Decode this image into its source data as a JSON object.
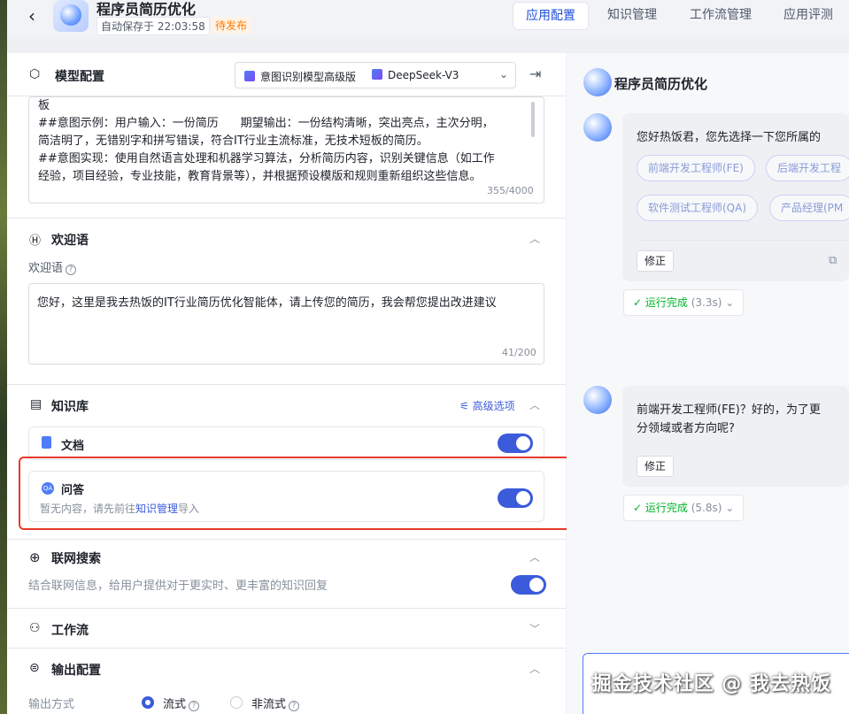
{
  "header": {
    "back_symbol": "‹",
    "app_title": "程序员简历优化",
    "autosave": "自动保存于 22:03:58",
    "status": "待发布",
    "tabs": [
      {
        "label": "应用配置",
        "active": true
      },
      {
        "label": "知识管理",
        "active": false
      },
      {
        "label": "工作流管理",
        "active": false
      },
      {
        "label": "应用评测",
        "active": false
      }
    ]
  },
  "model_config": {
    "title": "模型配置",
    "intent_model": "意图识别模型高级版",
    "llm_model": "DeepSeek-V3",
    "prompt_lines": [
      "板",
      "##意图示例：用户输入：一份简历      期望输出：一份结构清晰，突出亮点，主次分明，",
      "简洁明了，无错别字和拼写错误，符合IT行业主流标准，无技术短板的简历。",
      "##意图实现：使用自然语言处理和机器学习算法，分析简历内容，识别关键信息（如工作",
      "经验，项目经验，专业技能，教育背景等），并根据预设模版和规则重新组织这些信息。"
    ],
    "prompt_counter": "355/4000"
  },
  "welcome": {
    "title": "欢迎语",
    "label": "欢迎语",
    "text": "您好，这里是我去热饭的IT行业简历优化智能体，请上传您的简历，我会帮您提出改进建议",
    "counter": "41/200"
  },
  "knowledge": {
    "title": "知识库",
    "advanced": "高级选项",
    "doc_label": "文档",
    "doc_enabled": true,
    "qa_label": "问答",
    "qa_hint_prefix": "暂无内容，请先前往",
    "qa_hint_link": "知识管理",
    "qa_hint_suffix": "导入",
    "qa_enabled": true
  },
  "web_search": {
    "title": "联网搜索",
    "desc": "结合联网信息，给用户提供对于更实时、更丰富的知识回复",
    "enabled": true
  },
  "workflow": {
    "title": "工作流"
  },
  "output": {
    "title": "输出配置",
    "mode_label": "输出方式",
    "options": [
      {
        "label": "流式",
        "selected": true
      },
      {
        "label": "非流式",
        "selected": false
      }
    ]
  },
  "preview": {
    "title": "程序员简历优化",
    "msg1_text": "您好热饭君，您先选择一下您所属的",
    "chips": [
      "前端开发工程师(FE)",
      "后端开发工程",
      "软件测试工程师(QA)",
      "产品经理(PM"
    ],
    "fix_label": "修正",
    "run1_status": "运行完成",
    "run1_time": "(3.3s)",
    "msg2_line1": "前端开发工程师(FE)？好的，为了更",
    "msg2_line2": "分领域或者方向呢?",
    "run2_status": "运行完成",
    "run2_time": "(5.8s)"
  },
  "watermark": "掘金技术社区 @ 我去热饭"
}
